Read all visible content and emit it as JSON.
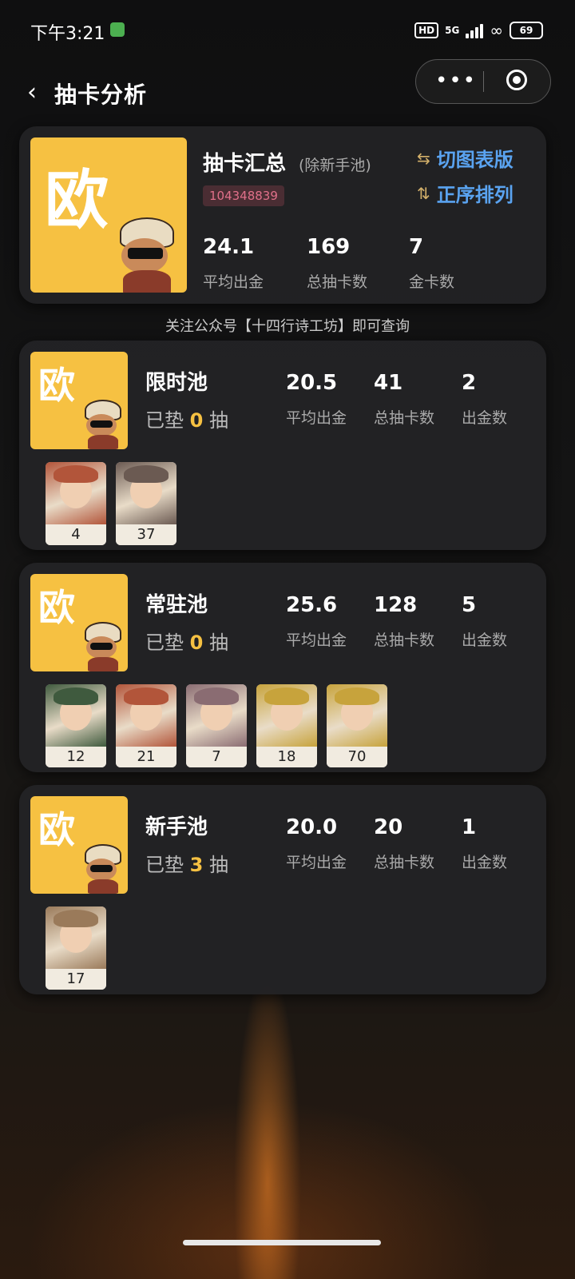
{
  "status_bar": {
    "time": "下午3:21",
    "hd": "HD",
    "network": "5G",
    "battery": "69"
  },
  "header": {
    "back_icon": "chevron-left-icon",
    "title": "抽卡分析"
  },
  "summary": {
    "badge": "欧",
    "title": "抽卡汇总",
    "subtitle": "(除新手池)",
    "uid": "104348839",
    "switch_label": "切图表版",
    "sort_label": "正序排列",
    "stats": [
      {
        "value": "24.1",
        "label": "平均出金"
      },
      {
        "value": "169",
        "label": "总抽卡数"
      },
      {
        "value": "7",
        "label": "金卡数"
      }
    ]
  },
  "notice": "关注公众号【十四行诗工坊】即可查询",
  "pools": [
    {
      "badge": "欧",
      "name": "限时池",
      "pity_prefix": "已垫",
      "pity": "0",
      "pity_suffix": "抽",
      "stats": [
        {
          "value": "20.5",
          "label": "平均出金"
        },
        {
          "value": "41",
          "label": "总抽卡数"
        },
        {
          "value": "2",
          "label": "出金数"
        }
      ],
      "chars": [
        {
          "count": "4",
          "color": "#b2553a"
        },
        {
          "count": "37",
          "color": "#6b5a52"
        }
      ]
    },
    {
      "badge": "欧",
      "name": "常驻池",
      "pity_prefix": "已垫",
      "pity": "0",
      "pity_suffix": "抽",
      "stats": [
        {
          "value": "25.6",
          "label": "平均出金"
        },
        {
          "value": "128",
          "label": "总抽卡数"
        },
        {
          "value": "5",
          "label": "出金数"
        }
      ],
      "chars": [
        {
          "count": "12",
          "color": "#3f5a3e"
        },
        {
          "count": "21",
          "color": "#b2553a"
        },
        {
          "count": "7",
          "color": "#8a6c72"
        },
        {
          "count": "18",
          "color": "#c7a33c"
        },
        {
          "count": "70",
          "color": "#c7a33c"
        }
      ]
    },
    {
      "badge": "欧",
      "name": "新手池",
      "pity_prefix": "已垫",
      "pity": "3",
      "pity_suffix": "抽",
      "stats": [
        {
          "value": "20.0",
          "label": "平均出金"
        },
        {
          "value": "20",
          "label": "总抽卡数"
        },
        {
          "value": "1",
          "label": "出金数"
        }
      ],
      "chars": [
        {
          "count": "17",
          "color": "#9a7a5a"
        }
      ]
    }
  ]
}
